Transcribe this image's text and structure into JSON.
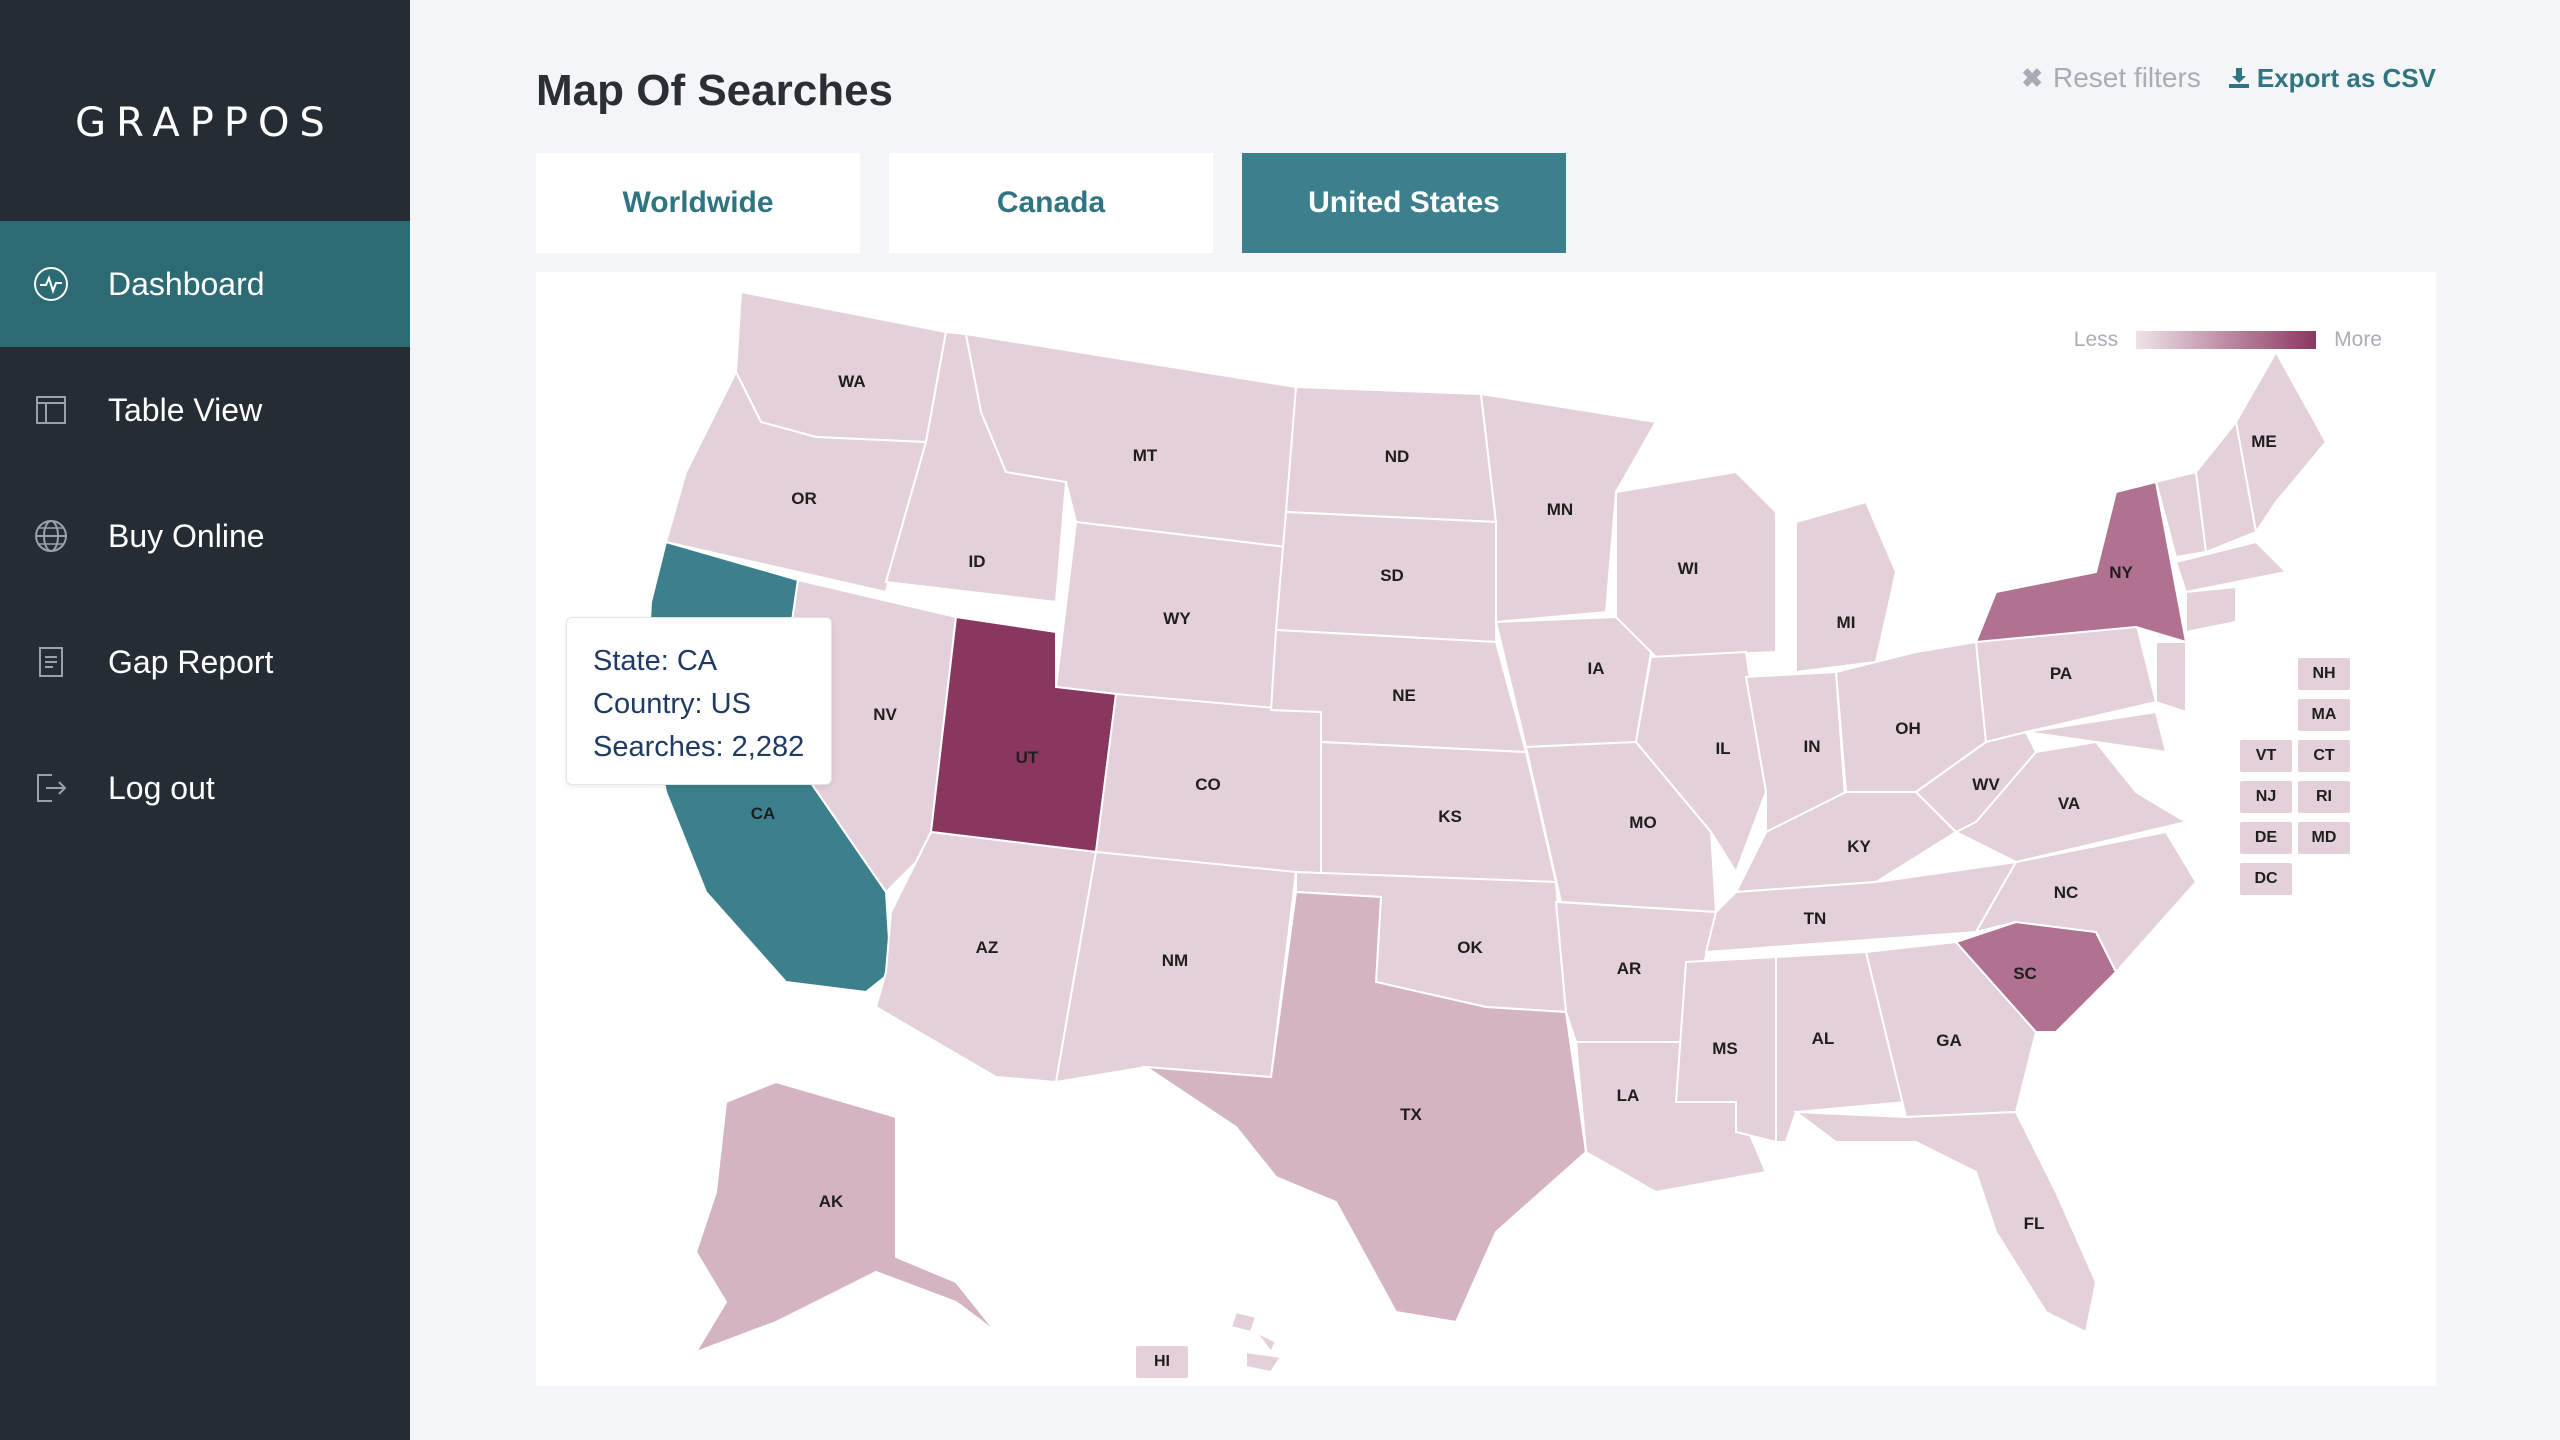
{
  "app": {
    "brand": "GRAPPOS"
  },
  "sidebar": {
    "items": [
      {
        "label": "Dashboard",
        "icon": "activity-icon",
        "active": true
      },
      {
        "label": "Table View",
        "icon": "table-icon",
        "active": false
      },
      {
        "label": "Buy Online",
        "icon": "globe-icon",
        "active": false
      },
      {
        "label": "Gap Report",
        "icon": "document-icon",
        "active": false
      },
      {
        "label": "Log out",
        "icon": "logout-icon",
        "active": false
      }
    ]
  },
  "header": {
    "title": "Map Of Searches",
    "reset_label": "Reset filters",
    "export_label": "Export as CSV"
  },
  "tabs": [
    {
      "label": "Worldwide",
      "active": false
    },
    {
      "label": "Canada",
      "active": false
    },
    {
      "label": "United States",
      "active": true
    }
  ],
  "legend": {
    "less": "Less",
    "more": "More"
  },
  "colors": {
    "accent": "#3b808c",
    "sidebar": "#262c33",
    "sidebar_active": "#2c6b73",
    "map_low": "#e4d0d9",
    "map_mid": "#d4b3c3",
    "map_high": "#b07290",
    "map_max": "#8a3760",
    "selected": "#3b808c"
  },
  "map": {
    "states": {
      "WA": "WA",
      "OR": "OR",
      "CA": "CA",
      "ID": "ID",
      "NV": "NV",
      "MT": "MT",
      "WY": "WY",
      "UT": "UT",
      "AZ": "AZ",
      "CO": "CO",
      "NM": "NM",
      "ND": "ND",
      "SD": "SD",
      "NE": "NE",
      "KS": "KS",
      "OK": "OK",
      "TX": "TX",
      "MN": "MN",
      "IA": "IA",
      "MO": "MO",
      "AR": "AR",
      "LA": "LA",
      "WI": "WI",
      "IL": "IL",
      "MI": "MI",
      "IN": "IN",
      "OH": "OH",
      "KY": "KY",
      "TN": "TN",
      "MS": "MS",
      "AL": "AL",
      "GA": "GA",
      "FL": "FL",
      "SC": "SC",
      "NC": "NC",
      "VA": "VA",
      "WV": "WV",
      "PA": "PA",
      "NY": "NY",
      "ME": "ME",
      "AK": "AK",
      "HI": "HI"
    },
    "small_states": [
      "NH",
      "MA",
      "VT",
      "CT",
      "NJ",
      "RI",
      "DE",
      "MD",
      "DC"
    ]
  },
  "tooltip": {
    "state": "State: CA",
    "country": "Country: US",
    "searches": "Searches: 2,282"
  }
}
